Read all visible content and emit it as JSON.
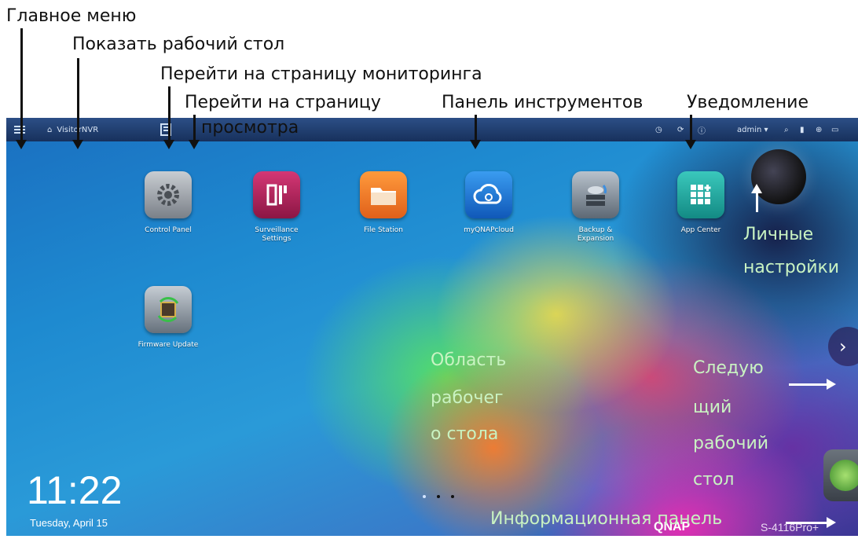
{
  "annotations": {
    "main_menu": "Главное меню",
    "show_desktop": "Показать рабочий стол",
    "monitoring_page": "Перейти на страницу мониторинга",
    "view_page_line1": "Перейти на страницу",
    "view_page_line2": "просмотра",
    "toolbar": "Панель инструментов",
    "notification": "Уведомление",
    "personal_settings_line1": "Личные",
    "personal_settings_line2": "настройки",
    "desktop_area_line1": "Область",
    "desktop_area_line2": "рабочег",
    "desktop_area_line3": "о стола",
    "next_desktop_line1": "Следую",
    "next_desktop_line2": "щий",
    "next_desktop_line3": "рабочий",
    "next_desktop_line4": "стол",
    "info_panel": "Информационная панель"
  },
  "topbar": {
    "home_label": "VisitorNVR",
    "user_label": "admin ▾"
  },
  "apps": [
    {
      "label": "Control Panel",
      "icon": "gear-icon",
      "color": "#8a8f96"
    },
    {
      "label": "Surveillance Settings",
      "icon": "tools-icon",
      "color": "#b51e5a"
    },
    {
      "label": "File Station",
      "icon": "folder-icon",
      "color": "#f07a20"
    },
    {
      "label": "myQNAPcloud",
      "icon": "cloud-icon",
      "color": "#1c7ad8"
    },
    {
      "label": "Backup & Expansion",
      "icon": "backup-icon",
      "color": "#7d8896"
    },
    {
      "label": "App Center",
      "icon": "grid-icon",
      "color": "#22a8a0"
    },
    {
      "label": "Firmware Update",
      "icon": "chip-icon",
      "color": "#7f8b96"
    }
  ],
  "clock": {
    "time": "11:22",
    "date": "Tuesday, April 15"
  },
  "brand": {
    "logo": "QNAP",
    "model": "S-4116Pro+"
  }
}
